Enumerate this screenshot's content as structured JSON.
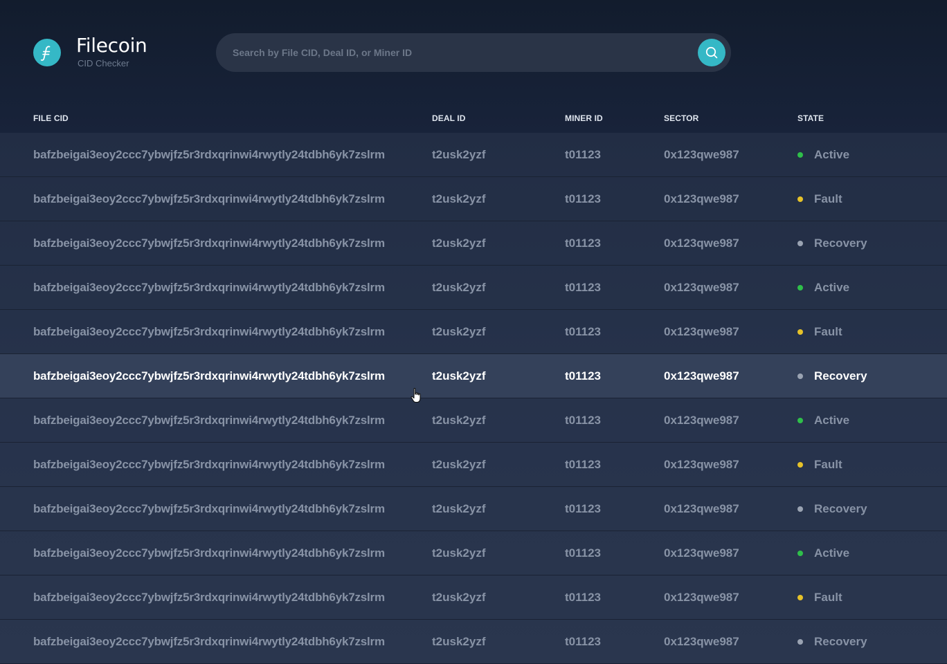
{
  "brand": {
    "name": "Filecoin",
    "subtitle": "CID Checker",
    "logo_icon": "filecoin-f-icon",
    "accent_color": "#35b8c6"
  },
  "search": {
    "placeholder": "Search by File CID, Deal ID, or Miner ID",
    "value": "",
    "button_icon": "search-icon"
  },
  "table": {
    "columns": [
      "FILE CID",
      "DEAL ID",
      "MINER ID",
      "SECTOR",
      "STATE"
    ],
    "state_colors": {
      "Active": "#2fbf4a",
      "Fault": "#e6c229",
      "Recovery": "#9aa3b2"
    },
    "hovered_row": 5,
    "rows": [
      {
        "cid": "bafzbeigai3eoy2ccc7ybwjfz5r3rdxqrinwi4rwytly24tdbh6yk7zslrm",
        "deal_id": "t2usk2yzf",
        "miner_id": "t01123",
        "sector": "0x123qwe987",
        "state": "Active"
      },
      {
        "cid": "bafzbeigai3eoy2ccc7ybwjfz5r3rdxqrinwi4rwytly24tdbh6yk7zslrm",
        "deal_id": "t2usk2yzf",
        "miner_id": "t01123",
        "sector": "0x123qwe987",
        "state": "Fault"
      },
      {
        "cid": "bafzbeigai3eoy2ccc7ybwjfz5r3rdxqrinwi4rwytly24tdbh6yk7zslrm",
        "deal_id": "t2usk2yzf",
        "miner_id": "t01123",
        "sector": "0x123qwe987",
        "state": "Recovery"
      },
      {
        "cid": "bafzbeigai3eoy2ccc7ybwjfz5r3rdxqrinwi4rwytly24tdbh6yk7zslrm",
        "deal_id": "t2usk2yzf",
        "miner_id": "t01123",
        "sector": "0x123qwe987",
        "state": "Active"
      },
      {
        "cid": "bafzbeigai3eoy2ccc7ybwjfz5r3rdxqrinwi4rwytly24tdbh6yk7zslrm",
        "deal_id": "t2usk2yzf",
        "miner_id": "t01123",
        "sector": "0x123qwe987",
        "state": "Fault"
      },
      {
        "cid": "bafzbeigai3eoy2ccc7ybwjfz5r3rdxqrinwi4rwytly24tdbh6yk7zslrm",
        "deal_id": "t2usk2yzf",
        "miner_id": "t01123",
        "sector": "0x123qwe987",
        "state": "Recovery"
      },
      {
        "cid": "bafzbeigai3eoy2ccc7ybwjfz5r3rdxqrinwi4rwytly24tdbh6yk7zslrm",
        "deal_id": "t2usk2yzf",
        "miner_id": "t01123",
        "sector": "0x123qwe987",
        "state": "Active"
      },
      {
        "cid": "bafzbeigai3eoy2ccc7ybwjfz5r3rdxqrinwi4rwytly24tdbh6yk7zslrm",
        "deal_id": "t2usk2yzf",
        "miner_id": "t01123",
        "sector": "0x123qwe987",
        "state": "Fault"
      },
      {
        "cid": "bafzbeigai3eoy2ccc7ybwjfz5r3rdxqrinwi4rwytly24tdbh6yk7zslrm",
        "deal_id": "t2usk2yzf",
        "miner_id": "t01123",
        "sector": "0x123qwe987",
        "state": "Recovery"
      },
      {
        "cid": "bafzbeigai3eoy2ccc7ybwjfz5r3rdxqrinwi4rwytly24tdbh6yk7zslrm",
        "deal_id": "t2usk2yzf",
        "miner_id": "t01123",
        "sector": "0x123qwe987",
        "state": "Active"
      },
      {
        "cid": "bafzbeigai3eoy2ccc7ybwjfz5r3rdxqrinwi4rwytly24tdbh6yk7zslrm",
        "deal_id": "t2usk2yzf",
        "miner_id": "t01123",
        "sector": "0x123qwe987",
        "state": "Fault"
      },
      {
        "cid": "bafzbeigai3eoy2ccc7ybwjfz5r3rdxqrinwi4rwytly24tdbh6yk7zslrm",
        "deal_id": "t2usk2yzf",
        "miner_id": "t01123",
        "sector": "0x123qwe987",
        "state": "Recovery"
      }
    ]
  }
}
